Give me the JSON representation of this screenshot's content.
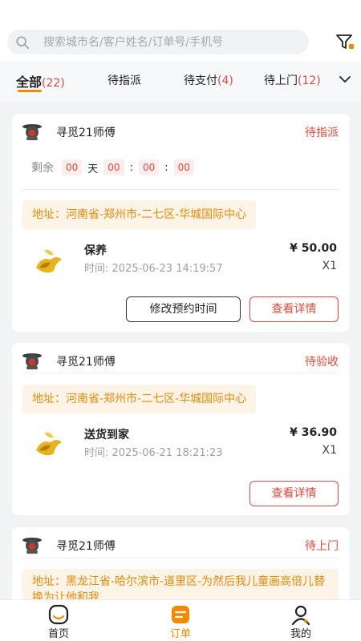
{
  "search": {
    "placeholder": "搜索城市名/客户姓名/订单号/手机号"
  },
  "tabs": [
    {
      "label": "全部",
      "count": "(22)"
    },
    {
      "label": "待指派",
      "count": ""
    },
    {
      "label": "待支付",
      "count": "(4)"
    },
    {
      "label": "待上门",
      "count": "(12)"
    }
  ],
  "orders": [
    {
      "shop": "寻觅21师傅",
      "status": "待指派",
      "countdown": {
        "label": "剩余",
        "days": "00",
        "day_unit": "天",
        "hours": "00",
        "minutes": "00",
        "seconds": "00",
        "sep": ":"
      },
      "address": "地址：河南省-郑州市-二七区-华城国际中心",
      "product": {
        "name": "保养",
        "time": "时间:  2025-06-23 14:19:57",
        "price": "¥ 50.00",
        "qty": "X1"
      },
      "buttons": {
        "modify": "修改预约时间",
        "detail": "查看详情"
      }
    },
    {
      "shop": "寻觅21师傅",
      "status": "待验收",
      "address": "地址：河南省-郑州市-二七区-华城国际中心",
      "product": {
        "name": "送货到家",
        "time": "时间:  2025-06-21 18:21:23",
        "price": "¥ 36.90",
        "qty": "X1"
      },
      "buttons": {
        "detail": "查看详情"
      }
    },
    {
      "shop": "寻觅21师傅",
      "status": "待上门",
      "address": "地址：黑龙江省-哈尔滨市-道里区-为然后我儿童画高倍儿替换为让他和我"
    }
  ],
  "navbar": [
    {
      "label": "首页"
    },
    {
      "label": "订单"
    },
    {
      "label": "我的"
    }
  ],
  "colors": {
    "accent": "#f08a00",
    "status_red": "#e2483d",
    "address_text": "#e48b08",
    "address_bg": "#fdf3e6"
  }
}
